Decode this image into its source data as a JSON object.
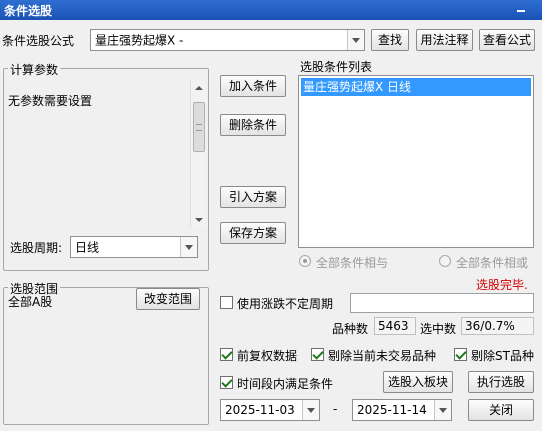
{
  "window": {
    "title": "条件选股"
  },
  "formula": {
    "label": "条件选股公式",
    "selected": "量庄强势起爆X  -",
    "find_button": "查找",
    "usage_button": "用法注释",
    "view_button": "查看公式"
  },
  "params": {
    "group_title": "计算参数",
    "message": "无参数需要设置",
    "period_label": "选股周期:",
    "period_value": "日线"
  },
  "middle_buttons": {
    "add": "加入条件",
    "delete": "删除条件",
    "import": "引入方案",
    "save": "保存方案"
  },
  "conditions": {
    "list_label": "选股条件列表",
    "items": [
      "量庄强势起爆X  日线"
    ],
    "radio_and": "全部条件相与",
    "radio_or": "全部条件相或",
    "status": "选股完毕."
  },
  "range": {
    "group_title": "选股范围",
    "value": "全部A股",
    "change_button": "改变范围"
  },
  "options": {
    "variable_period_label": "使用涨跌不定周期",
    "variable_period_value": "",
    "count_label": "品种数",
    "count_value": "5463",
    "selected_label": "选中数",
    "selected_value": "36/0.7%",
    "adjust_label": "前复权数据",
    "exclude_suspended_label": "剔除当前未交易品种",
    "exclude_st_label": "剔除ST品种",
    "timerange_label": "时间段内满足条件",
    "to_block_button": "选股入板块",
    "run_button": "执行选股",
    "start_date": "2025-11-03",
    "date_sep": "-",
    "end_date": "2025-11-14",
    "close_button": "关闭"
  },
  "colors": {
    "title_bar": "#1a52b4",
    "selection": "#3399ff",
    "status_text": "#d40000"
  }
}
